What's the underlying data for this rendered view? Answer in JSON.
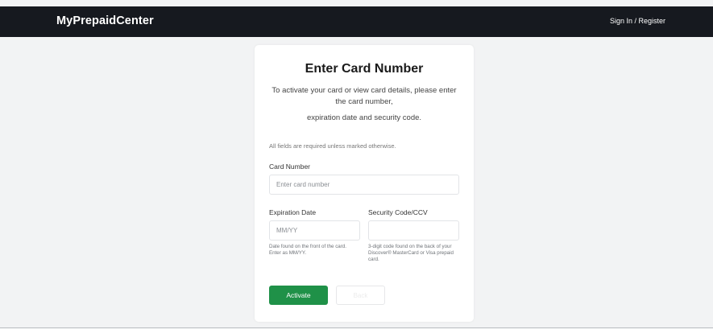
{
  "header": {
    "brand": "MyPrepaidCenter",
    "signin_label": "Sign In / Register"
  },
  "card": {
    "title": "Enter Card Number",
    "intro_line1": "To activate your card or view card details, please enter the card number,",
    "intro_line2": "expiration date and security code.",
    "required_note": "All fields are required unless marked otherwise.",
    "card_number": {
      "label": "Card Number",
      "placeholder": "Enter card number",
      "value": ""
    },
    "expiration": {
      "label": "Expiration Date",
      "placeholder": "MM/YY",
      "value": "",
      "hint": "Date found on the front of the card. Enter as MM/YY."
    },
    "security": {
      "label": "Security Code/CCV",
      "placeholder": "",
      "value": "",
      "hint": "3-digit code found on the back of your Discover® MasterCard or Visa prepaid card."
    },
    "activate_label": "Activate",
    "back_label": "Back"
  },
  "colors": {
    "header_bg": "#16191f",
    "page_bg": "#f2f3f4",
    "primary_button": "#1f9148"
  }
}
